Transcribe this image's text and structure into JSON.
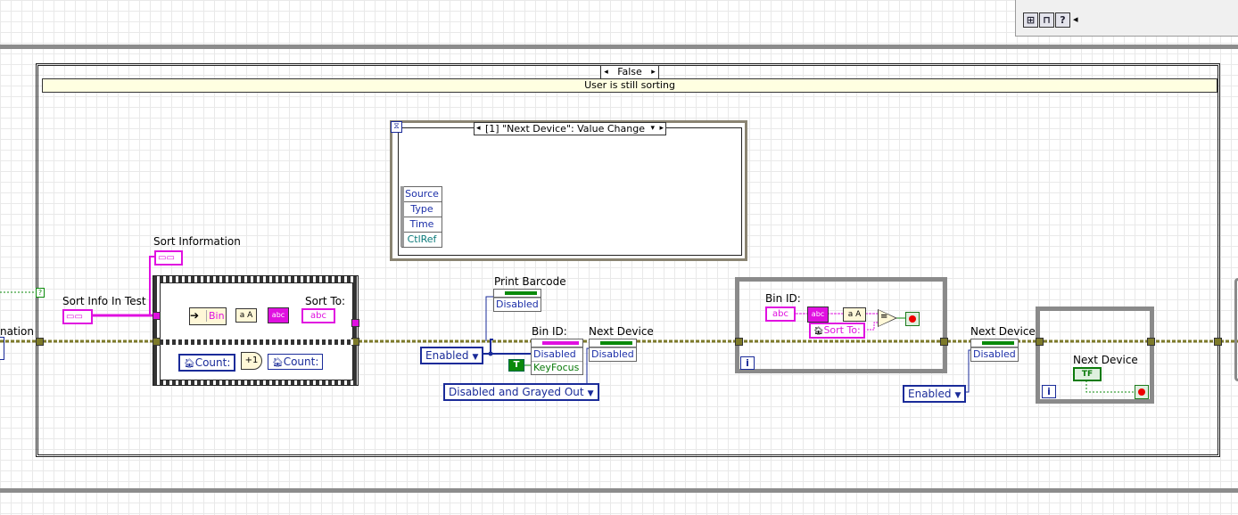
{
  "toolbar": {
    "icons": [
      "block-diagram-icon",
      "lock-icon",
      "help-icon"
    ],
    "help": "?",
    "scroll": "◂"
  },
  "case_structure": {
    "selector": "False",
    "label": "User is still sorting"
  },
  "event_structure": {
    "selector": "[1] \"Next Device\": Value Change",
    "data_nodes": [
      "Source",
      "Type",
      "Time",
      "CtlRef"
    ]
  },
  "left_edge_label": "nation",
  "sort_info": {
    "cluster_label": "Sort Information",
    "test_label": "Sort Info In Test",
    "cluster_icon": "▭▭",
    "bin_label": "Bin",
    "sort_to_label": "Sort To:",
    "abc": "abc",
    "ab": "a A",
    "count_local": "Count:",
    "count_local2": "Count:",
    "plus_one": "+1"
  },
  "print_barcode": {
    "label": "Print Barcode",
    "prop": "Disabled"
  },
  "bin_id_prop": {
    "label": "Bin ID:",
    "props": [
      "Disabled",
      "KeyFocus"
    ]
  },
  "next_device_prop1": {
    "label": "Next Device",
    "prop": "Disabled"
  },
  "enabled_ring1": "Enabled",
  "disabled_ring": "Disabled and Grayed Out",
  "true_const": "T",
  "while1": {
    "bin_label": "Bin ID:",
    "abc": "abc",
    "sort_to": "Sort To:",
    "eq": "=",
    "ab": "a A"
  },
  "next_device_prop2": {
    "label": "Next Device",
    "prop": "Disabled"
  },
  "enabled_ring2": "Enabled",
  "while2": {
    "label": "Next Device",
    "tf": "TF"
  },
  "iteration": "i"
}
